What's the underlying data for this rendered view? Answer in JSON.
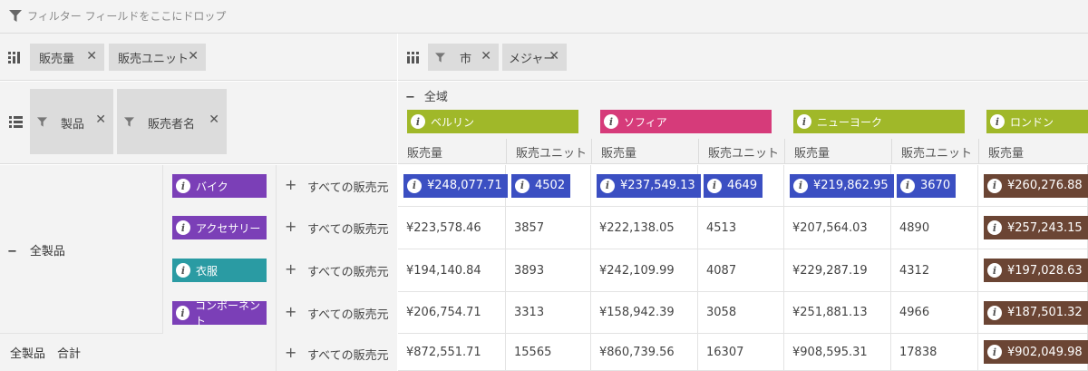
{
  "filter_bar": {
    "hint": "フィルター フィールドをここにドロップ"
  },
  "data_chips": [
    {
      "label": "販売量"
    },
    {
      "label": "販売ユニット"
    }
  ],
  "column_chips": [
    {
      "label": "市"
    },
    {
      "label": "メジャー"
    }
  ],
  "row_chips": [
    {
      "label": "製品"
    },
    {
      "label": "販売者名"
    }
  ],
  "column_root": "全域",
  "cities": [
    {
      "name": "ベルリン",
      "color": "#a0b829"
    },
    {
      "name": "ソフィア",
      "color": "#d63b7a"
    },
    {
      "name": "ニューヨーク",
      "color": "#a0b829"
    },
    {
      "name": "ロンドン",
      "color": "#a0b829"
    }
  ],
  "measures": [
    "販売量",
    "販売ユニット",
    "販売量",
    "販売ユニット",
    "販売量",
    "販売ユニット",
    "販売量"
  ],
  "row_root": "全製品",
  "total_label": "全製品　合計",
  "seller_label": "すべての販売元",
  "products": [
    {
      "name": "バイク",
      "color": "#7b3fb7"
    },
    {
      "name": "アクセサリー",
      "color": "#7b3fb7"
    },
    {
      "name": "衣服",
      "color": "#2a9ba3"
    },
    {
      "name": "コンポーネント",
      "color": "#7b3fb7"
    }
  ],
  "rows": [
    [
      "¥248,077.71",
      "4502",
      "¥237,549.13",
      "4649",
      "¥219,862.95",
      "3670",
      "¥260,276.88"
    ],
    [
      "¥223,578.46",
      "3857",
      "¥222,138.05",
      "4513",
      "¥207,564.03",
      "4890",
      "¥257,243.15"
    ],
    [
      "¥194,140.84",
      "3893",
      "¥242,109.99",
      "4087",
      "¥229,287.19",
      "4312",
      "¥197,028.63"
    ],
    [
      "¥206,754.71",
      "3313",
      "¥158,942.39",
      "3058",
      "¥251,881.13",
      "4966",
      "¥187,501.32"
    ],
    [
      "¥872,551.71",
      "15565",
      "¥860,739.56",
      "16307",
      "¥908,595.31",
      "17838",
      "¥902,049.98"
    ]
  ],
  "highlight_colors": {
    "blue": "#3b4fc2",
    "brown": "#6b4534"
  }
}
